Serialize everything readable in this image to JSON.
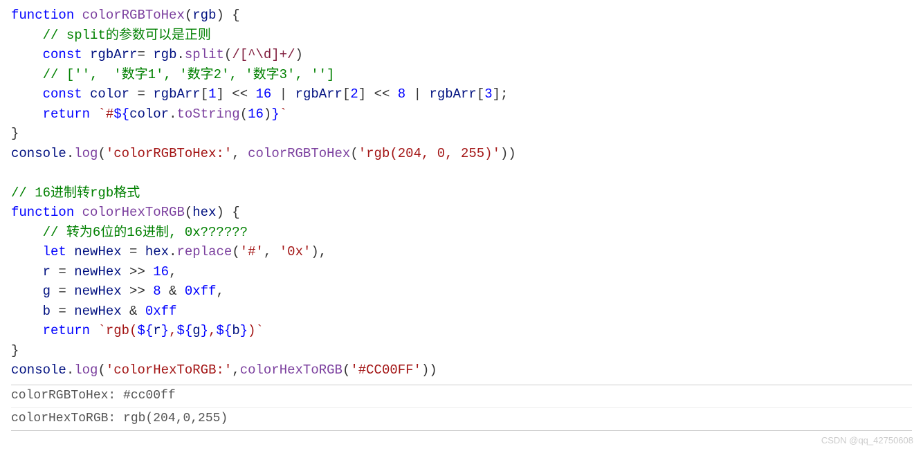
{
  "code": {
    "l1": {
      "kw": "function",
      "fn": "colorRGBToHex",
      "param": "rgb"
    },
    "l2": {
      "comment": "// split的参数可以是正则"
    },
    "l3": {
      "kw": "const",
      "var": "rgbArr",
      "eq": "= ",
      "obj": "rgb",
      "dot": ".",
      "method": "split",
      "regex": "/[^\\d]+/"
    },
    "l4": {
      "comment": "// ['',  '数字1', '数字2', '数字3', '']"
    },
    "l5": {
      "kw": "const",
      "var": "color",
      "a": "rgbArr",
      "i1": "1",
      "s1": "16",
      "i2": "2",
      "s2": "8",
      "i3": "3"
    },
    "l6": {
      "kw": "return",
      "tick": "`",
      "hash": "#",
      "db": "$",
      "ob": "{",
      "obj": "color",
      "method": "toString",
      "arg": "16",
      "cb": "}",
      "tick2": "`"
    },
    "l7": {
      "brace": "}"
    },
    "l8": {
      "obj": "console",
      "method": "log",
      "s1": "'colorRGBToHex:'",
      "comma": ", ",
      "fn": "colorRGBToHex",
      "s2": "'rgb(204, 0, 255)'"
    },
    "l9": {
      "blank": ""
    },
    "l10": {
      "comment": "// 16进制转rgb格式"
    },
    "l11": {
      "kw": "function",
      "fn": "colorHexToRGB",
      "param": "hex"
    },
    "l12": {
      "comment": "// 转为6位的16进制, 0x??????"
    },
    "l13": {
      "kw": "let",
      "var": "newHex",
      "obj": "hex",
      "method": "replace",
      "s1": "'#'",
      "s2": "'0x'"
    },
    "l14": {
      "var": "r",
      "src": "newHex",
      "shift": "16"
    },
    "l15": {
      "var": "g",
      "src": "newHex",
      "shift": "8",
      "mask": "0xff"
    },
    "l16": {
      "var": "b",
      "src": "newHex",
      "mask": "0xff"
    },
    "l17": {
      "kw": "return",
      "tick": "`",
      "pfx": "rgb(",
      "r": "r",
      "g": "g",
      "b": "b",
      "sfx": ")",
      "tick2": "`"
    },
    "l18": {
      "brace": "}"
    },
    "l19": {
      "obj": "console",
      "method": "log",
      "s1": "'colorHexToRGB:'",
      "fn": "colorHexToRGB",
      "s2": "'#CC00FF'"
    }
  },
  "output": {
    "line1": "colorRGBToHex: #cc00ff",
    "line2": "colorHexToRGB: rgb(204,0,255)"
  },
  "watermark": "CSDN @qq_42750608"
}
